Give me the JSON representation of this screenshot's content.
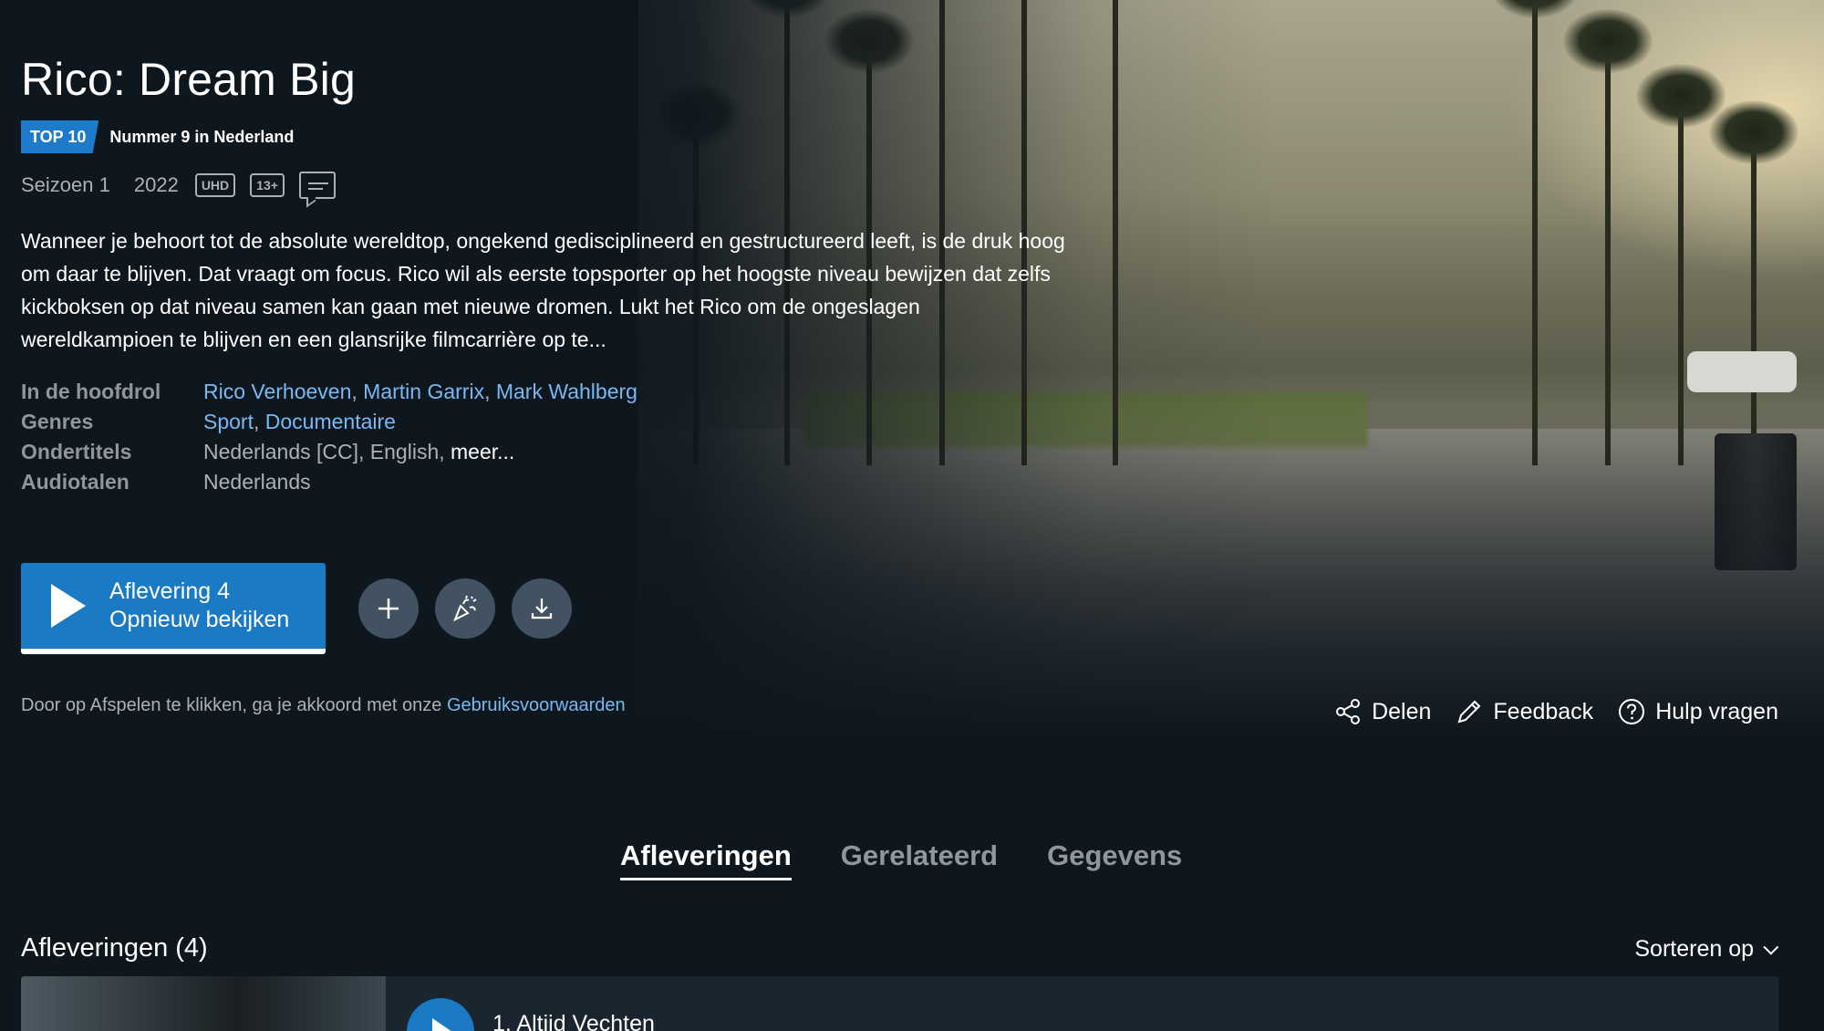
{
  "title": "Rico: Dream Big",
  "ranking": {
    "badge": "TOP 10",
    "text": "Nummer 9 in Nederland"
  },
  "meta": {
    "season": "Seizoen 1",
    "year": "2022",
    "quality_badge": "UHD",
    "age_badge": "13+"
  },
  "synopsis": "Wanneer je behoort tot de absolute wereldtop, ongekend gedisciplineerd en gestructureerd leeft, is de druk hoog om daar te blijven. Dat vraagt om focus. Rico wil als eerste topsporter op het hoogste niveau bewijzen dat zelfs kickboksen op dat niveau samen kan gaan met nieuwe dromen. Lukt het Rico om de ongeslagen wereldkampioen te blijven en een glansrijke filmcarrière op te...",
  "details": {
    "cast_label": "In de hoofdrol",
    "cast": [
      "Rico Verhoeven",
      "Martin Garrix",
      "Mark Wahlberg"
    ],
    "genres_label": "Genres",
    "genres": [
      "Sport",
      "Documentaire"
    ],
    "subtitles_label": "Ondertitels",
    "subtitles": "Nederlands [CC], English,",
    "subtitles_more": "meer...",
    "audio_label": "Audiotalen",
    "audio": "Nederlands"
  },
  "play_button": {
    "line1": "Aflevering 4",
    "line2": "Opnieuw bekijken"
  },
  "icon_buttons": [
    "plus-icon",
    "party-popper-icon",
    "download-icon"
  ],
  "terms": {
    "text": "Door op Afspelen te klikken, ga je akkoord met onze",
    "link": "Gebruiksvoorwaarden"
  },
  "actions": {
    "share": "Delen",
    "feedback": "Feedback",
    "help": "Hulp vragen"
  },
  "tabs": [
    {
      "label": "Afleveringen",
      "active": true
    },
    {
      "label": "Gerelateerd",
      "active": false
    },
    {
      "label": "Gegevens",
      "active": false
    }
  ],
  "episodes": {
    "heading": "Afleveringen (4)",
    "sort_label": "Sorteren op",
    "items": [
      {
        "title": "1. Altijd Vechten"
      }
    ]
  },
  "colors": {
    "background": "#0f171e",
    "accent": "#1a7ac4",
    "link": "#79b8f3"
  }
}
